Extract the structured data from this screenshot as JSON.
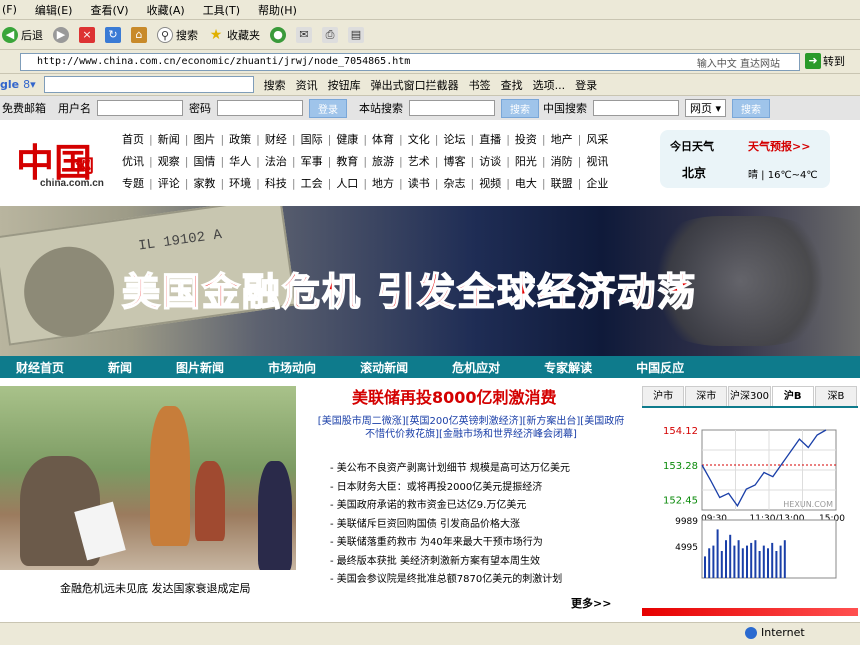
{
  "menubar": [
    "(F)",
    "编辑(E)",
    "查看(V)",
    "收藏(A)",
    "工具(T)",
    "帮助(H)"
  ],
  "toolbar": {
    "back": "后退",
    "search": "搜索",
    "favorites": "收藏夹"
  },
  "address": {
    "url": "http://www.china.com.cn/economic/zhuanti/jrwj/node_7054865.htm",
    "hint": "输入中文 直达网站",
    "go": "转到"
  },
  "googlebar": {
    "brand": "gle",
    "search_btn": "搜索",
    "info": "资讯",
    "pins": "按钮库",
    "popup": "弹出式窗口拦截器",
    "bookmarks": "书签",
    "spell": "查找",
    "options": "选项...",
    "login": "登录"
  },
  "loginbar": {
    "mail": "免费邮箱",
    "username": "用户名",
    "password": "密码",
    "login": "登录",
    "site_search": "本站搜索",
    "search": "搜索",
    "china_search": "中国搜索",
    "scope": "网页",
    "search2": "搜索"
  },
  "logo": {
    "char": "中国",
    "cn": "网",
    "url": "china.com.cn"
  },
  "nav": [
    [
      "首页",
      "新闻",
      "图片",
      "政策",
      "财经",
      "国际",
      "健康",
      "体育",
      "文化",
      "论坛",
      "直播",
      "投资",
      "地产",
      "风采"
    ],
    [
      "优讯",
      "观察",
      "国情",
      "华人",
      "法治",
      "军事",
      "教育",
      "旅游",
      "艺术",
      "博客",
      "访谈",
      "阳光",
      "消防",
      "视讯"
    ],
    [
      "专题",
      "评论",
      "家教",
      "环境",
      "科技",
      "工会",
      "人口",
      "地方",
      "读书",
      "杂志",
      "视频",
      "电大",
      "联盟",
      "企业"
    ]
  ],
  "weather": {
    "title": "今日天气",
    "link": "天气预报>>",
    "city": "北京",
    "cond": "晴 | 16℃~4℃"
  },
  "banner": {
    "title": "美国金融危机 引发全球经济动荡",
    "bill_number": "IL 19102 A"
  },
  "catnav": [
    "财经首页",
    "新闻",
    "图片新闻",
    "市场动向",
    "滚动新闻",
    "危机应对",
    "专家解读",
    "中国反应"
  ],
  "photo_caption": "金融危机远未见底 发达国家衰退成定局",
  "headline": "美联储再投8000亿刺激消费",
  "sublinks": "[美国股市周二微涨][英国200亿英镑刺激经济][新方案出台][美国政府不惜代价救花旗][金融市场和世界经济峰会闭幕]",
  "news": [
    "美公布不良资产剥离计划细节 规模是高可达万亿美元",
    "日本财务大臣：或将再投2000亿美元提振经济",
    "美国政府承诺的救市资金已达亿9.万亿美元",
    "美联储斥巨资回购国债 引发商品价格大涨",
    "美联储落重药救市 为40年来最大干预市场行为",
    "最终版本获批 美经济刺激新方案有望本周生效",
    "美国会参议院是终批准总额7870亿美元的刺激计划"
  ],
  "more": "更多>>",
  "tabs": [
    "沪市",
    "深市",
    "沪深300",
    "沪B",
    "深B"
  ],
  "chart_data": {
    "type": "line",
    "yticks": [
      "154.12",
      "153.28",
      "152.45"
    ],
    "xticks": [
      "09:30",
      "11:30/13:00",
      "15:00"
    ],
    "watermark": "HEXUN.COM",
    "vol_ticks": [
      "9989",
      "4995"
    ],
    "prices": [
      153.28,
      152.9,
      152.5,
      152.6,
      152.3,
      152.7,
      152.8,
      153.1,
      153.0,
      153.3,
      153.6,
      153.9,
      153.7,
      154.0,
      154.12
    ],
    "volume": [
      0.4,
      0.55,
      0.6,
      0.9,
      0.5,
      0.7,
      0.8,
      0.6,
      0.7,
      0.55,
      0.6,
      0.65,
      0.7,
      0.5,
      0.6,
      0.55,
      0.65,
      0.5,
      0.6,
      0.7
    ]
  },
  "status": {
    "zone": "Internet"
  }
}
